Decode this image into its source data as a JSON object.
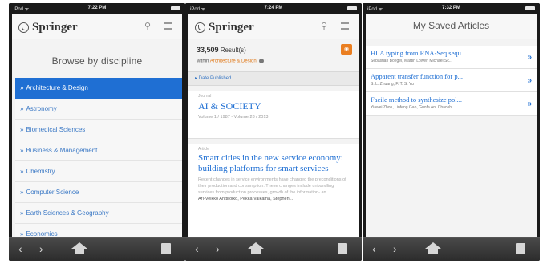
{
  "screens": [
    {
      "status": {
        "carrier": "iPod ᯤ",
        "time": "7:22 PM"
      },
      "brand": "Springer",
      "title": "Browse by discipline",
      "disciplines": [
        "Architecture & Design",
        "Astronomy",
        "Biomedical Sciences",
        "Business & Management",
        "Chemistry",
        "Computer Science",
        "Earth Sciences & Geography",
        "Economics"
      ],
      "active_index": 0
    },
    {
      "status": {
        "carrier": "iPod ᯤ",
        "time": "7:24 PM"
      },
      "brand": "Springer",
      "results_count": "33,509",
      "results_label": "Result(s)",
      "within_prefix": "within",
      "within_discipline": "Architecture & Design",
      "filter_label": "▸ Date Published",
      "journal_card": {
        "kind": "Journal",
        "title": "AI & SOCIETY",
        "volumes": "Volume 1 / 1987 - Volume 28 / 2013"
      },
      "article_card": {
        "kind": "Article",
        "title": "Smart cities in the new service economy: building platforms for smart services",
        "abstract": "Recent changes in service environments have changed the preconditions of their production and consumption. These changes include unbundling services from production processes, growth of the information- an...",
        "authors": "Arı-Veikko Anttiroiko, Pekka Valkama, Stephen..."
      }
    },
    {
      "status": {
        "carrier": "iPod ᯤ",
        "time": "7:32 PM"
      },
      "title": "My Saved Articles",
      "saved": [
        {
          "title": "HLA typing from RNA-Seq sequ...",
          "authors": "Sebastian Boegel, Martin Löwer, Michael Sc..."
        },
        {
          "title": "Apparent transfer function for p...",
          "authors": "S. L. Zhuang, F. T. S. Yu"
        },
        {
          "title": "Facile method to synthesize pol...",
          "authors": "Yiawei Zhou, Linfeng Gao, Guofa An, Chaosh..."
        }
      ]
    }
  ],
  "footer": {
    "back": "‹",
    "forward": "›",
    "home": "home-icon",
    "bookmarks": "bookmarks-icon"
  },
  "colors": {
    "accent": "#1f6fd3",
    "rss": "#ea7e20",
    "footer": "#3a3a3a"
  }
}
